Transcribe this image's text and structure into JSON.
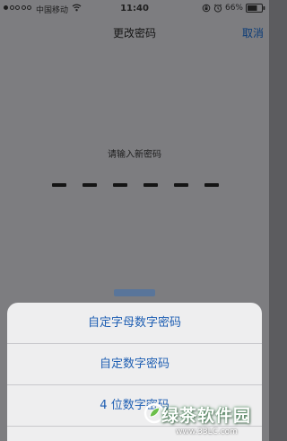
{
  "status_bar": {
    "carrier": "中国移动",
    "time": "11:40",
    "battery_percent": "66%",
    "signal_bars_filled": 1,
    "icons": [
      "wifi-icon",
      "orientation-lock-icon",
      "alarm-icon",
      "battery-icon"
    ]
  },
  "nav": {
    "title": "更改密码",
    "cancel_label": "取消"
  },
  "passcode": {
    "prompt": "请输入新密码",
    "digit_count": 6
  },
  "action_sheet": {
    "options": [
      "自定字母数字密码",
      "自定数字密码",
      "4 位数字密码"
    ]
  },
  "watermark": {
    "title": "绿茶软件园",
    "url": "www.33LC.com"
  },
  "colors": {
    "accent": "#1f5fb3",
    "dimmed_background": "#7d7d80",
    "sheet_background": "#eeeeef"
  }
}
